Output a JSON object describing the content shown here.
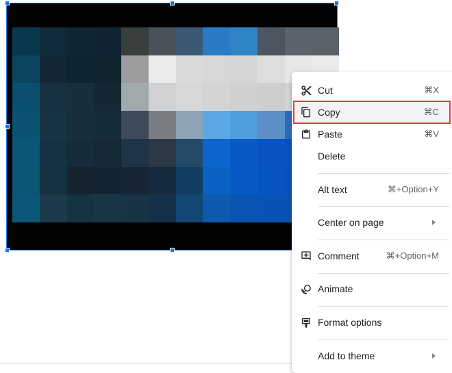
{
  "context_menu": {
    "cut": {
      "label": "Cut",
      "shortcut": "⌘X",
      "icon": "scissors-icon"
    },
    "copy": {
      "label": "Copy",
      "shortcut": "⌘C",
      "icon": "copy-icon",
      "highlighted": true
    },
    "paste": {
      "label": "Paste",
      "shortcut": "⌘V",
      "icon": "clipboard-icon"
    },
    "delete": {
      "label": "Delete"
    },
    "alt_text": {
      "label": "Alt text",
      "shortcut": "⌘+Option+Y"
    },
    "center_on_page": {
      "label": "Center on page",
      "has_submenu": true
    },
    "comment": {
      "label": "Comment",
      "shortcut": "⌘+Option+M",
      "icon": "add-comment-icon"
    },
    "animate": {
      "label": "Animate",
      "icon": "animate-icon"
    },
    "format_options": {
      "label": "Format options",
      "icon": "format-options-icon"
    },
    "add_to_theme": {
      "label": "Add to theme",
      "has_submenu": true
    }
  },
  "colors": {
    "selection": "#1a73e8",
    "highlight_border": "#e5403a",
    "menu_hover": "#f1f3f4",
    "shortcut_text": "#5f6368"
  }
}
